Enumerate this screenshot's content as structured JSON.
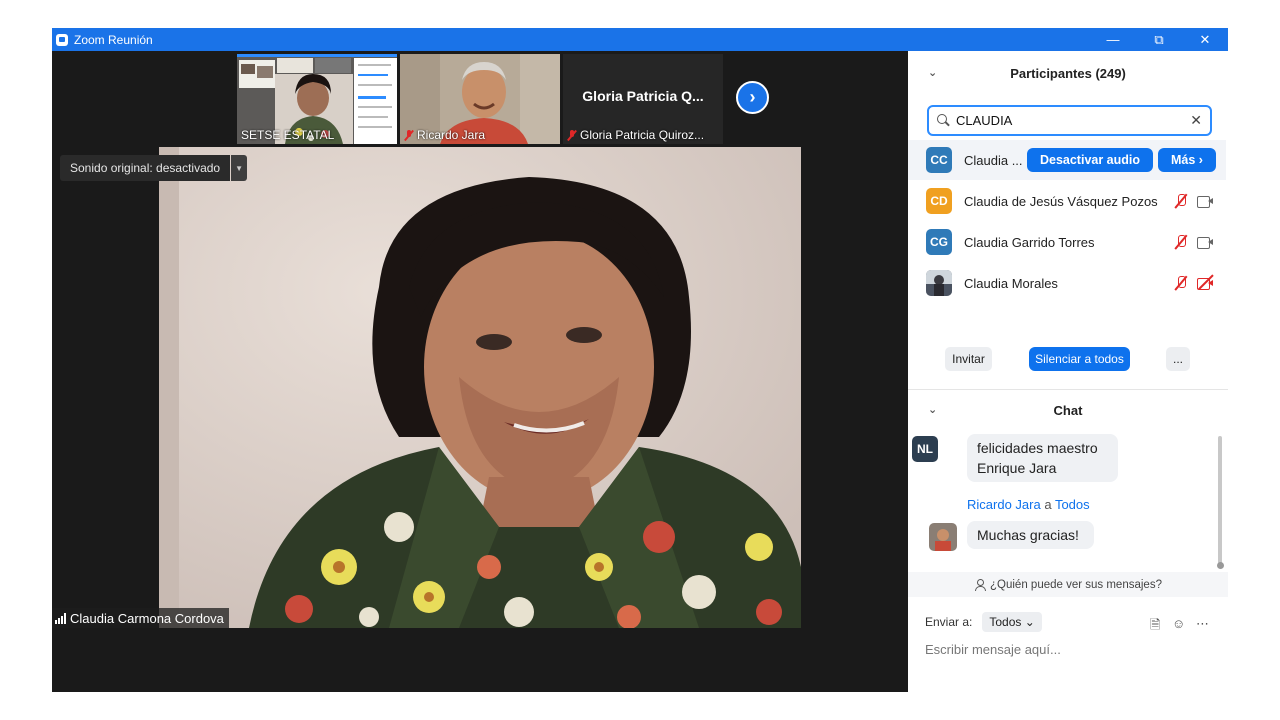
{
  "window": {
    "title": "Zoom Reunión"
  },
  "gallery": {
    "thumbs": [
      {
        "label": "SETSE ESTATAL",
        "muted": false
      },
      {
        "label": "Ricardo Jara",
        "muted": true
      },
      {
        "label": "Gloria Patricia Quiroz...",
        "muted": true,
        "display_name": "Gloria Patricia Q..."
      }
    ]
  },
  "main_video": {
    "sound_label": "Sonido original: desactivado",
    "speaker_name": "Claudia Carmona Cordova"
  },
  "participants": {
    "title": "Participantes (249)",
    "search_value": "CLAUDIA",
    "rows": [
      {
        "initials": "CC",
        "name": "Claudia ...",
        "color": "#2f7ab8"
      },
      {
        "initials": "CD",
        "name": "Claudia de Jesús Vásquez Pozos",
        "color": "#f0a020"
      },
      {
        "initials": "CG",
        "name": "Claudia Garrido Torres",
        "color": "#2f7ab8"
      },
      {
        "initials": "",
        "name": "Claudia Morales",
        "color": "#5a6470"
      }
    ],
    "row_actions": {
      "mute_label": "Desactivar audio",
      "more_label": "Más ›"
    },
    "buttons": {
      "invite": "Invitar",
      "mute_all": "Silenciar a todos",
      "more": "..."
    }
  },
  "chat": {
    "title": "Chat",
    "messages": [
      {
        "avatar": "NL",
        "text_line1": "felicidades maestro",
        "text_line2": "Enrique Jara"
      },
      {
        "sender": "Ricardo Jara",
        "to_word": "a",
        "recipient": "Todos",
        "text": "Muchas gracias!"
      }
    ],
    "who_can_see": "¿Quién puede ver sus mensajes?",
    "send_to_label": "Enviar a:",
    "send_to_value": "Todos",
    "input_placeholder": "Escribir mensaje aquí..."
  }
}
